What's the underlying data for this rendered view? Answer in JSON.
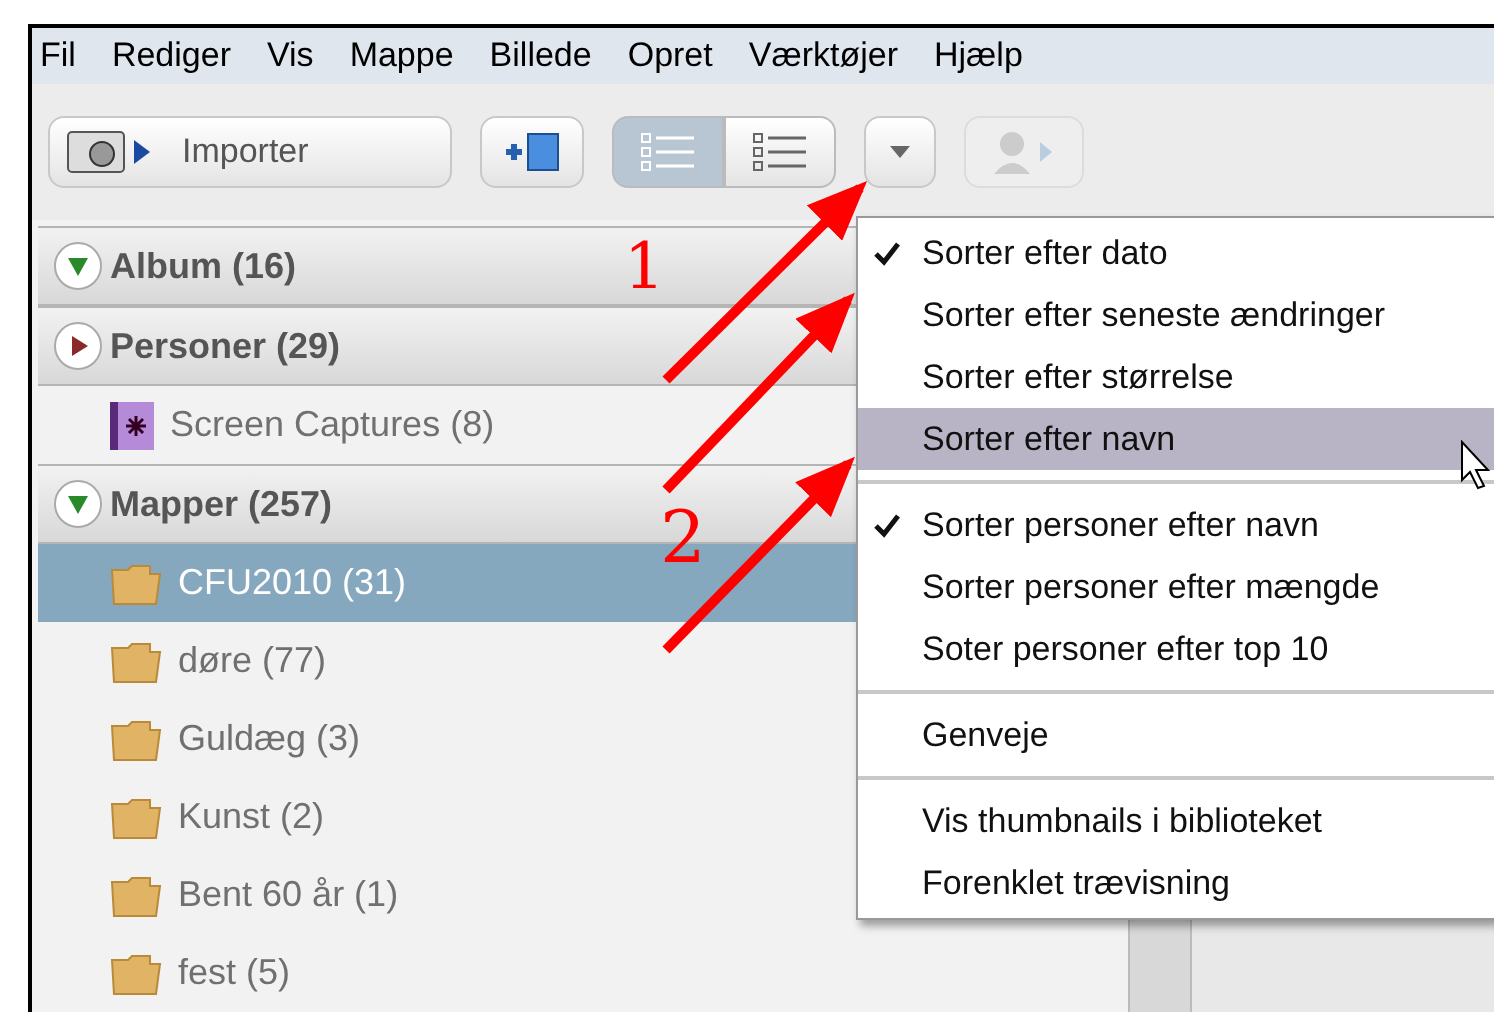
{
  "menu_bar": [
    "Fil",
    "Rediger",
    "Vis",
    "Mappe",
    "Billede",
    "Opret",
    "Værktøjer",
    "Hjælp"
  ],
  "toolbar": {
    "import_button": "Importer",
    "view_buttons": [
      {
        "selected": true
      },
      {
        "selected": false
      }
    ]
  },
  "sidebar": {
    "rows": [
      {
        "kind": "header",
        "label": "Album (16)",
        "expanded": true
      },
      {
        "kind": "header",
        "label": "Personer (29)",
        "expanded": false
      },
      {
        "kind": "album",
        "label": "Screen Captures (8)",
        "selected": false
      },
      {
        "kind": "header",
        "label": "Mapper (257)",
        "expanded": true
      },
      {
        "kind": "folder",
        "label": "CFU2010 (31)",
        "selected": true
      },
      {
        "kind": "folder",
        "label": "døre (77)",
        "selected": false
      },
      {
        "kind": "folder",
        "label": "Guldæg (3)",
        "selected": false
      },
      {
        "kind": "folder",
        "label": "Kunst (2)",
        "selected": false
      },
      {
        "kind": "folder",
        "label": "Bent 60 år (1)",
        "selected": false
      },
      {
        "kind": "folder",
        "label": "fest (5)",
        "selected": false
      }
    ]
  },
  "dropdown_menu": [
    {
      "kind": "item",
      "label": "Sorter efter dato",
      "checked": true,
      "selected": false
    },
    {
      "kind": "item",
      "label": "Sorter efter seneste ændringer",
      "checked": false,
      "selected": false
    },
    {
      "kind": "item",
      "label": "Sorter efter størrelse",
      "checked": false,
      "selected": false
    },
    {
      "kind": "item",
      "label": "Sorter efter navn",
      "checked": false,
      "selected": true
    },
    {
      "kind": "separator"
    },
    {
      "kind": "item",
      "label": "Sorter personer efter navn",
      "checked": true,
      "selected": false
    },
    {
      "kind": "item",
      "label": "Sorter personer efter mængde",
      "checked": false,
      "selected": false
    },
    {
      "kind": "item",
      "label": "Soter personer efter top 10",
      "checked": false,
      "selected": false
    },
    {
      "kind": "separator"
    },
    {
      "kind": "item",
      "label": "Genveje",
      "checked": false,
      "selected": false
    },
    {
      "kind": "separator"
    },
    {
      "kind": "item",
      "label": "Vis thumbnails i biblioteket",
      "checked": false,
      "selected": false
    },
    {
      "kind": "item",
      "label": "Forenklet trævisning",
      "checked": false,
      "selected": false
    }
  ],
  "annotations": [
    "1",
    "2"
  ]
}
